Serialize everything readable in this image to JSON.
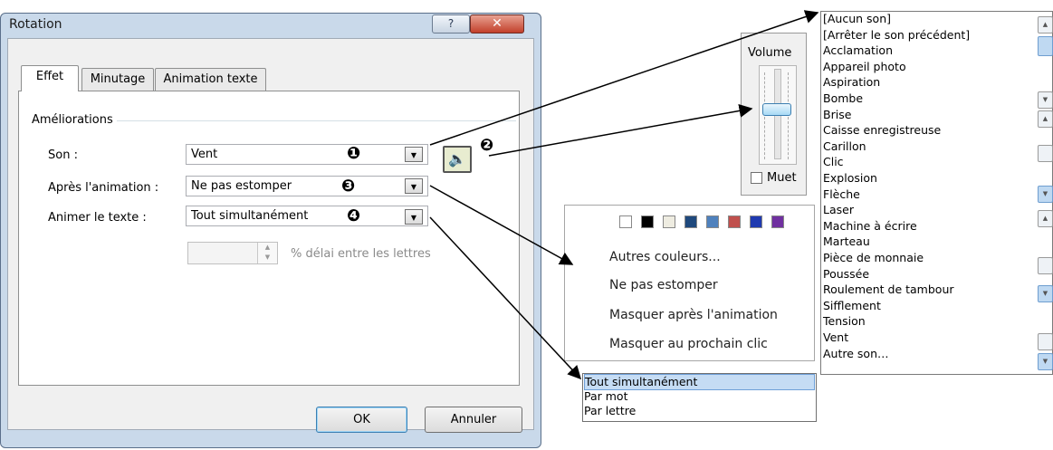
{
  "dialog": {
    "title": "Rotation",
    "help_label": "?",
    "close_label": "✕",
    "tabs": [
      "Effet",
      "Minutage",
      "Animation texte"
    ],
    "group_label": "Améliorations",
    "rows": [
      {
        "label": "Son :",
        "value": "Vent",
        "marker": "❶"
      },
      {
        "label": "Après l'animation :",
        "value": "Ne pas estomper",
        "marker": "❸"
      },
      {
        "label": "Animer le texte :",
        "value": "Tout simultanément",
        "marker": "❹"
      }
    ],
    "speaker_marker": "❷",
    "delay_label": "% délai entre les lettres",
    "ok_label": "OK",
    "cancel_label": "Annuler"
  },
  "volume": {
    "label": "Volume",
    "mute_label": "Muet",
    "level": 0.45
  },
  "sounds": [
    "[Aucun son]",
    "[Arrêter le son précédent]",
    "Acclamation",
    "Appareil photo",
    "Aspiration",
    "Bombe",
    "Brise",
    "Caisse enregistreuse",
    "Carillon",
    "Clic",
    "Explosion",
    "Flèche",
    "Laser",
    "Machine à écrire",
    "Marteau",
    "Pièce de monnaie",
    "Poussée",
    "Roulement de tambour",
    "Sifflement",
    "Tension",
    "Vent",
    "Autre son…"
  ],
  "after_menu": {
    "colors": [
      "#ffffff",
      "#000000",
      "#eeece1",
      "#1f497d",
      "#4f81bd",
      "#c0504d",
      "#1f3ab0",
      "#7030a0"
    ],
    "items": [
      "Autres couleurs...",
      "Ne pas estomper",
      "Masquer après l'animation",
      "Masquer au prochain clic"
    ]
  },
  "text_options": [
    "Tout simultanément",
    "Par mot",
    "Par lettre"
  ]
}
